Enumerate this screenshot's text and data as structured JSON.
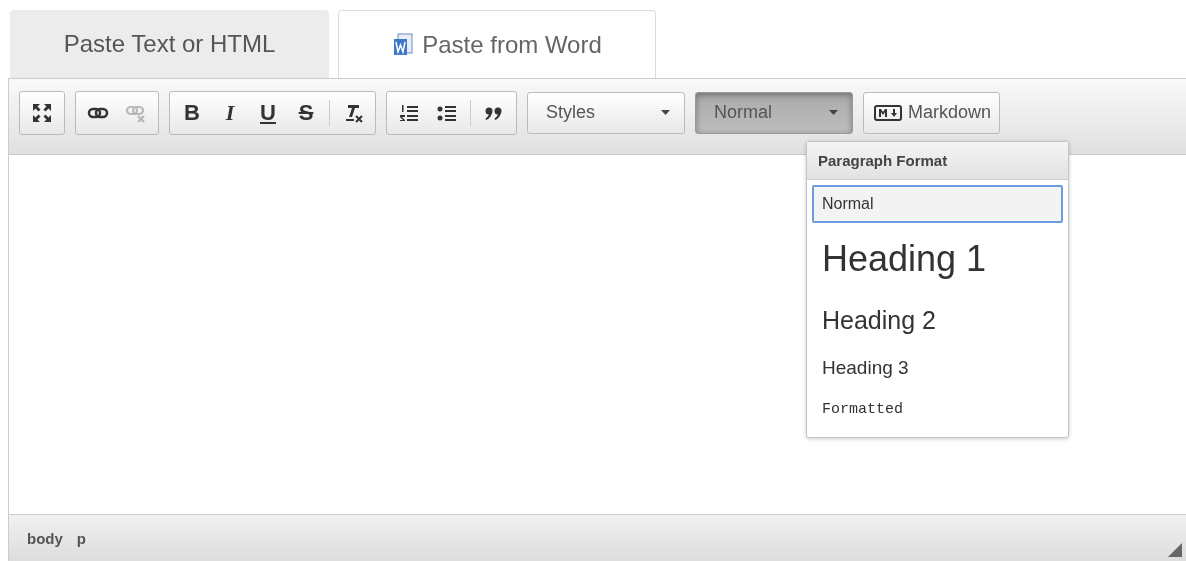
{
  "tabs": [
    {
      "label": "Paste Text or HTML",
      "kind": "text",
      "selected": false
    },
    {
      "label": "Paste from Word",
      "kind": "word",
      "selected": true
    }
  ],
  "toolbar": {
    "groups": [
      [
        {
          "kind": "maximize",
          "disabled": false
        }
      ],
      [
        {
          "kind": "link",
          "disabled": false
        },
        {
          "kind": "unlink",
          "disabled": true
        }
      ],
      [
        {
          "kind": "bold",
          "label": "B",
          "disabled": false
        },
        {
          "kind": "italic",
          "label": "I",
          "disabled": false
        },
        {
          "kind": "underline",
          "label": "U",
          "disabled": false
        },
        {
          "kind": "strike",
          "label": "S",
          "disabled": false
        },
        {
          "kind": "separator"
        },
        {
          "kind": "clear-format",
          "disabled": false
        }
      ],
      [
        {
          "kind": "numbered-list",
          "disabled": false
        },
        {
          "kind": "bulleted-list",
          "disabled": false
        },
        {
          "kind": "separator"
        },
        {
          "kind": "quote",
          "disabled": false
        }
      ]
    ],
    "combos": [
      {
        "label": "Styles",
        "open": false
      },
      {
        "label": "Normal",
        "open": true
      }
    ],
    "markdown": {
      "label": "Markdown"
    }
  },
  "format_menu": {
    "title": "Paragraph Format",
    "items": [
      {
        "label": "Normal",
        "kind": "normal",
        "selected": true
      },
      {
        "label": "Heading 1",
        "kind": "h1",
        "selected": false
      },
      {
        "label": "Heading 2",
        "kind": "h2",
        "selected": false
      },
      {
        "label": "Heading 3",
        "kind": "h3",
        "selected": false
      },
      {
        "label": "Formatted",
        "kind": "pre",
        "selected": false
      }
    ]
  },
  "status_bar": {
    "path": [
      "body",
      "p"
    ]
  }
}
